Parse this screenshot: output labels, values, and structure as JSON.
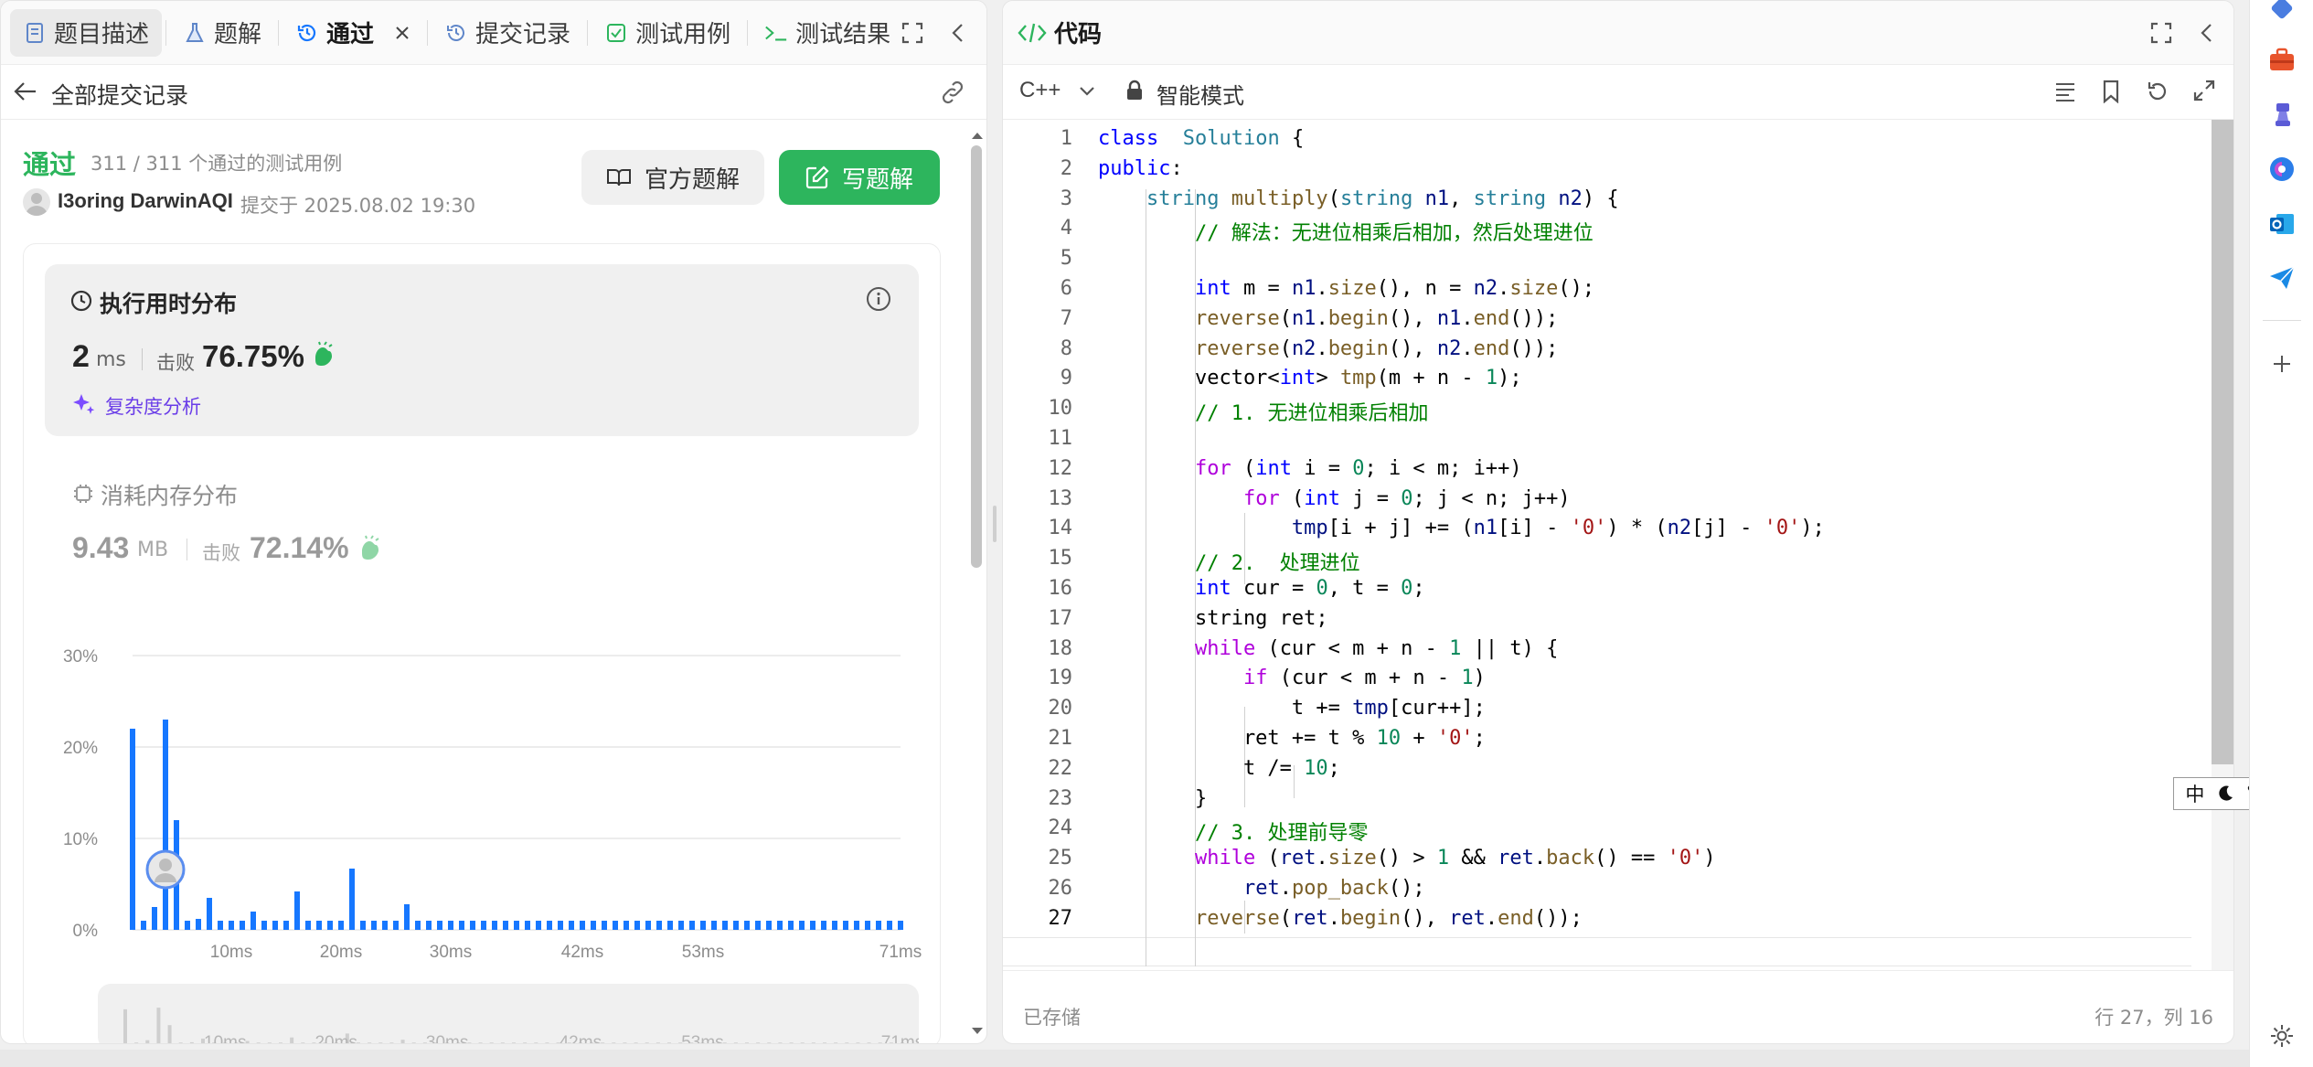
{
  "left_tabs": {
    "desc": "题目描述",
    "solution": "题解",
    "accepted": "通过",
    "submissions": "提交记录",
    "testcases": "测试用例",
    "testresult": "测试结果"
  },
  "submission_header": {
    "back_label": "全部提交记录"
  },
  "result": {
    "status": "通过",
    "tests_text": "311 / 311 个通过的测试用例",
    "user": "I3oring DarwinAQI",
    "submitted_at": "提交于 2025.08.02 19:30",
    "official_btn": "官方题解",
    "write_btn": "写题解"
  },
  "runtime": {
    "title": "执行用时分布",
    "value": "2",
    "unit": "ms",
    "beat_label": "击败",
    "beat_value": "76.75%",
    "complexity_link": "复杂度分析"
  },
  "memory": {
    "title": "消耗内存分布",
    "value": "9.43",
    "unit": "MB",
    "beat_label": "击败",
    "beat_value": "72.14%"
  },
  "chart_data": {
    "type": "bar",
    "x": [
      1,
      2,
      3,
      4,
      5,
      6,
      7,
      8,
      9,
      10,
      11,
      12,
      13,
      14,
      15,
      16,
      17,
      18,
      19,
      20,
      21,
      22,
      23,
      24,
      25,
      26,
      27,
      28,
      29,
      30,
      31,
      32,
      33,
      34,
      35,
      36,
      37,
      38,
      39,
      40,
      41,
      42,
      43,
      44,
      45,
      46,
      47,
      48,
      49,
      50,
      51,
      52,
      53,
      54,
      55,
      56,
      57,
      58,
      59,
      60,
      61,
      62,
      63,
      64,
      65,
      66,
      67,
      68,
      69,
      70,
      71
    ],
    "values": [
      22,
      1,
      2.5,
      23,
      12,
      1,
      1.2,
      3.5,
      1,
      1,
      1,
      2,
      1,
      1,
      1,
      4.2,
      1,
      1,
      1,
      1,
      6.7,
      1,
      1,
      1,
      1,
      2.8,
      1,
      1,
      1,
      1,
      1,
      1,
      1,
      1,
      1,
      1,
      1,
      1,
      1,
      1,
      1,
      1,
      1,
      1,
      1,
      1,
      1,
      1,
      1,
      1,
      1,
      1,
      1,
      1,
      1,
      1,
      1,
      1,
      1,
      1,
      1,
      1,
      1,
      1,
      1,
      1,
      1,
      1,
      1,
      1,
      1
    ],
    "highlight_x": 3,
    "ylim": [
      0,
      30
    ],
    "yticks": [
      "0%",
      "10%",
      "20%",
      "30%"
    ],
    "xticks": [
      "10ms",
      "20ms",
      "30ms",
      "42ms",
      "53ms",
      "71ms"
    ],
    "mini_xticks": [
      "10ms",
      "20ms",
      "30ms",
      "42ms",
      "53ms",
      "71ms"
    ],
    "grid": true,
    "bar_color": "#1677ff"
  },
  "editor": {
    "title": "代码",
    "language": "C++",
    "mode": "智能模式",
    "status": "已存储",
    "cursor": "行 27，列 16",
    "lines": [
      [
        [
          "kw",
          "class"
        ],
        [
          "",
          "  "
        ],
        [
          "ty",
          "Solution"
        ],
        [
          "",
          " {"
        ]
      ],
      [
        [
          "kw",
          "public"
        ],
        [
          "",
          ":"
        ]
      ],
      [
        [
          "",
          "    "
        ],
        [
          "ty",
          "string"
        ],
        [
          "",
          " "
        ],
        [
          "fn",
          "multiply"
        ],
        [
          "",
          "("
        ],
        [
          "ty",
          "string"
        ],
        [
          "",
          " "
        ],
        [
          "va",
          "n1"
        ],
        [
          "",
          ", "
        ],
        [
          "ty",
          "string"
        ],
        [
          "",
          " "
        ],
        [
          "va",
          "n2"
        ],
        [
          "",
          ") {"
        ]
      ],
      [
        [
          "",
          "        "
        ],
        [
          "cm",
          "// 解法：无进位相乘后相加，然后处理进位"
        ]
      ],
      [
        [
          "",
          ""
        ]
      ],
      [
        [
          "",
          "        "
        ],
        [
          "kw",
          "int"
        ],
        [
          "",
          " m = "
        ],
        [
          "va",
          "n1"
        ],
        [
          "",
          "."
        ],
        [
          "fn",
          "size"
        ],
        [
          "",
          "(), n = "
        ],
        [
          "va",
          "n2"
        ],
        [
          "",
          "."
        ],
        [
          "fn",
          "size"
        ],
        [
          "",
          "();"
        ]
      ],
      [
        [
          "",
          "        "
        ],
        [
          "fn",
          "reverse"
        ],
        [
          "",
          "("
        ],
        [
          "va",
          "n1"
        ],
        [
          "",
          "."
        ],
        [
          "fn",
          "begin"
        ],
        [
          "",
          "(), "
        ],
        [
          "va",
          "n1"
        ],
        [
          "",
          "."
        ],
        [
          "fn",
          "end"
        ],
        [
          "",
          "());"
        ]
      ],
      [
        [
          "",
          "        "
        ],
        [
          "fn",
          "reverse"
        ],
        [
          "",
          "("
        ],
        [
          "va",
          "n2"
        ],
        [
          "",
          "."
        ],
        [
          "fn",
          "begin"
        ],
        [
          "",
          "(), "
        ],
        [
          "va",
          "n2"
        ],
        [
          "",
          "."
        ],
        [
          "fn",
          "end"
        ],
        [
          "",
          "());"
        ]
      ],
      [
        [
          "",
          "        vector<"
        ],
        [
          "kw",
          "int"
        ],
        [
          "",
          "> "
        ],
        [
          "fn",
          "tmp"
        ],
        [
          "",
          "(m + n - "
        ],
        [
          "nu",
          "1"
        ],
        [
          "",
          "); "
        ]
      ],
      [
        [
          "",
          "        "
        ],
        [
          "cm",
          "// 1. 无进位相乘后相加"
        ]
      ],
      [
        [
          "",
          ""
        ]
      ],
      [
        [
          "",
          "        "
        ],
        [
          "ct",
          "for"
        ],
        [
          "",
          " ("
        ],
        [
          "kw",
          "int"
        ],
        [
          "",
          " i = "
        ],
        [
          "nu",
          "0"
        ],
        [
          "",
          "; i < m; i++)"
        ]
      ],
      [
        [
          "",
          "            "
        ],
        [
          "ct",
          "for"
        ],
        [
          "",
          " ("
        ],
        [
          "kw",
          "int"
        ],
        [
          "",
          " j = "
        ],
        [
          "nu",
          "0"
        ],
        [
          "",
          "; j < n; j++)"
        ]
      ],
      [
        [
          "",
          "                "
        ],
        [
          "va",
          "tmp"
        ],
        [
          "",
          "[i + j] += ("
        ],
        [
          "va",
          "n1"
        ],
        [
          "",
          "[i] - "
        ],
        [
          "st",
          "'0'"
        ],
        [
          "",
          ") * ("
        ],
        [
          "va",
          "n2"
        ],
        [
          "",
          "[j] - "
        ],
        [
          "st",
          "'0'"
        ],
        [
          "",
          ");"
        ]
      ],
      [
        [
          "",
          "        "
        ],
        [
          "cm",
          "// 2.  处理进位"
        ]
      ],
      [
        [
          "",
          "        "
        ],
        [
          "kw",
          "int"
        ],
        [
          "",
          " cur = "
        ],
        [
          "nu",
          "0"
        ],
        [
          "",
          ", t = "
        ],
        [
          "nu",
          "0"
        ],
        [
          "",
          ";"
        ]
      ],
      [
        [
          "",
          "        string ret;"
        ]
      ],
      [
        [
          "",
          "        "
        ],
        [
          "ct",
          "while"
        ],
        [
          "",
          " (cur < m + n - "
        ],
        [
          "nu",
          "1"
        ],
        [
          "",
          " || t) {"
        ]
      ],
      [
        [
          "",
          "            "
        ],
        [
          "ct",
          "if"
        ],
        [
          "",
          " (cur < m + n - "
        ],
        [
          "nu",
          "1"
        ],
        [
          "",
          ")"
        ]
      ],
      [
        [
          "",
          "                t += "
        ],
        [
          "va",
          "tmp"
        ],
        [
          "",
          "[cur++];"
        ]
      ],
      [
        [
          "",
          "            ret += t % "
        ],
        [
          "nu",
          "10"
        ],
        [
          "",
          " + "
        ],
        [
          "st",
          "'0'"
        ],
        [
          "",
          ";"
        ]
      ],
      [
        [
          "",
          "            t /= "
        ],
        [
          "nu",
          "10"
        ],
        [
          "",
          ";"
        ]
      ],
      [
        [
          "",
          "        }"
        ]
      ],
      [
        [
          "",
          "        "
        ],
        [
          "cm",
          "// 3. 处理前导零"
        ]
      ],
      [
        [
          "",
          "        "
        ],
        [
          "ct",
          "while"
        ],
        [
          "",
          " ("
        ],
        [
          "va",
          "ret"
        ],
        [
          "",
          "."
        ],
        [
          "fn",
          "size"
        ],
        [
          "",
          "() > "
        ],
        [
          "nu",
          "1"
        ],
        [
          "",
          " && "
        ],
        [
          "va",
          "ret"
        ],
        [
          "",
          "."
        ],
        [
          "fn",
          "back"
        ],
        [
          "",
          "() == "
        ],
        [
          "st",
          "'0'"
        ],
        [
          "",
          ")"
        ]
      ],
      [
        [
          "",
          "            "
        ],
        [
          "va",
          "ret"
        ],
        [
          "",
          "."
        ],
        [
          "fn",
          "pop_back"
        ],
        [
          "",
          "();"
        ]
      ],
      [
        [
          "",
          "        "
        ],
        [
          "fn",
          "reverse"
        ],
        [
          "",
          "("
        ],
        [
          "va",
          "ret"
        ],
        [
          "",
          "."
        ],
        [
          "fn",
          "begin"
        ],
        [
          "",
          "(), "
        ],
        [
          "va",
          "ret"
        ],
        [
          "",
          "."
        ],
        [
          "fn",
          "end"
        ],
        [
          "",
          "());"
        ]
      ]
    ]
  },
  "ime": {
    "lang": "中"
  }
}
